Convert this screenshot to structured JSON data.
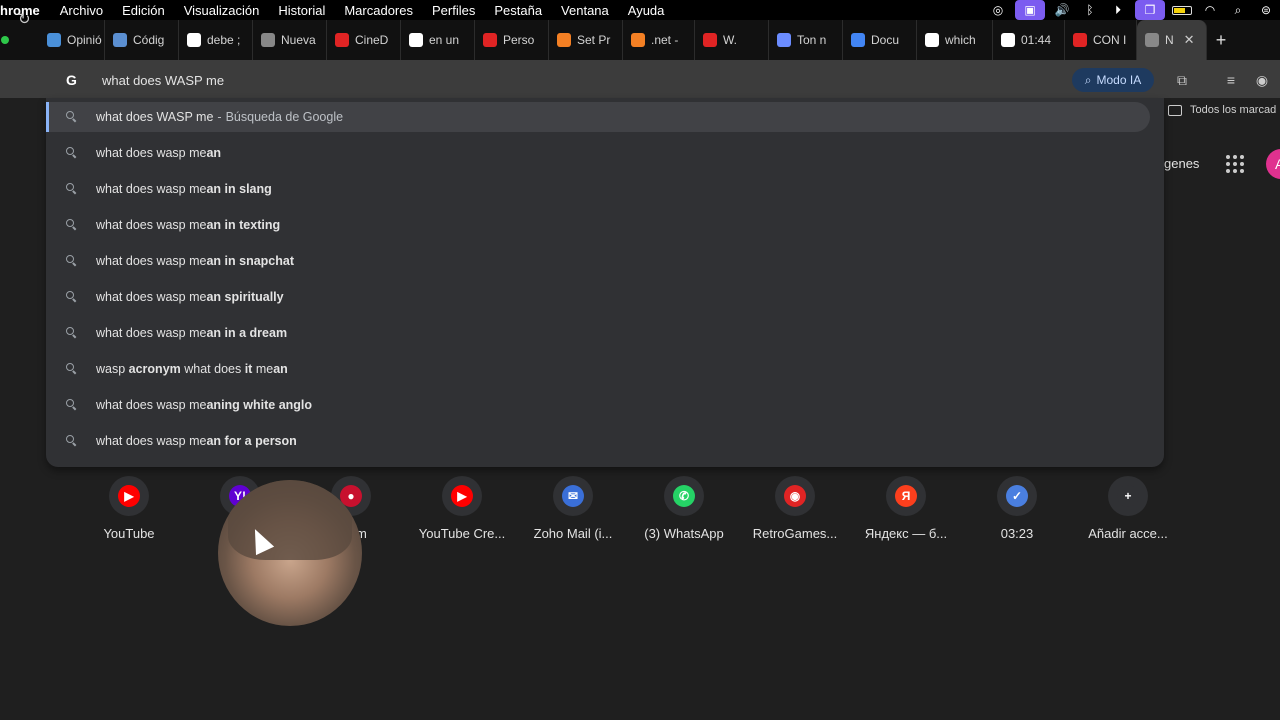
{
  "menubar": {
    "app": "hrome",
    "items": [
      "Archivo",
      "Edición",
      "Visualización",
      "Historial",
      "Marcadores",
      "Perfiles",
      "Pestaña",
      "Ventana",
      "Ayuda"
    ]
  },
  "tabs": [
    {
      "label": "Opinió",
      "color": "#4a90d9"
    },
    {
      "label": "Códig",
      "color": "#5b8fd1"
    },
    {
      "label": "debe ;",
      "color": "#ffffff"
    },
    {
      "label": "Nueva",
      "color": "#888888"
    },
    {
      "label": "CineD",
      "color": "#e02424"
    },
    {
      "label": "en un",
      "color": "#ffffff"
    },
    {
      "label": "Perso",
      "color": "#e02424"
    },
    {
      "label": "Set Pr",
      "color": "#f48024"
    },
    {
      "label": ".net -",
      "color": "#f48024"
    },
    {
      "label": "W.",
      "color": "#e02424"
    },
    {
      "label": "Ton n",
      "color": "#6b8cff"
    },
    {
      "label": "Docu",
      "color": "#4285f4"
    },
    {
      "label": "which",
      "color": "#ffffff"
    },
    {
      "label": "01:44",
      "color": "#ffffff"
    },
    {
      "label": "CON I",
      "color": "#e02424"
    },
    {
      "label": "N",
      "color": "#888888",
      "active": true
    }
  ],
  "omnibox": {
    "value": "what does WASP me",
    "modo_ia": "Modo IA"
  },
  "bookmarks": {
    "all_bookmarks": "Todos los marcad"
  },
  "google_page": {
    "images_link": "genes",
    "avatar_letter": "A"
  },
  "suggestions": [
    {
      "parts": [
        {
          "t": "what does WASP me",
          "b": false
        }
      ],
      "suffix_sep": "-",
      "suffix": "Búsqueda de Google",
      "selected": true
    },
    {
      "parts": [
        {
          "t": "what does wasp me",
          "b": false
        },
        {
          "t": "an",
          "b": true
        }
      ]
    },
    {
      "parts": [
        {
          "t": "what does wasp me",
          "b": false
        },
        {
          "t": "an in slang",
          "b": true
        }
      ]
    },
    {
      "parts": [
        {
          "t": "what does wasp me",
          "b": false
        },
        {
          "t": "an in texting",
          "b": true
        }
      ]
    },
    {
      "parts": [
        {
          "t": "what does wasp me",
          "b": false
        },
        {
          "t": "an in snapchat",
          "b": true
        }
      ]
    },
    {
      "parts": [
        {
          "t": "what does wasp me",
          "b": false
        },
        {
          "t": "an spiritually",
          "b": true
        }
      ]
    },
    {
      "parts": [
        {
          "t": "what does wasp me",
          "b": false
        },
        {
          "t": "an in a dream",
          "b": true
        }
      ]
    },
    {
      "parts": [
        {
          "t": "wasp ",
          "b": false
        },
        {
          "t": "acronym",
          "b": true
        },
        {
          "t": " what does ",
          "b": false
        },
        {
          "t": "it",
          "b": true
        },
        {
          "t": " me",
          "b": false
        },
        {
          "t": "an",
          "b": true
        }
      ]
    },
    {
      "parts": [
        {
          "t": "what does wasp me",
          "b": false
        },
        {
          "t": "aning white anglo",
          "b": true
        }
      ]
    },
    {
      "parts": [
        {
          "t": "what does wasp me",
          "b": false
        },
        {
          "t": "an for a person",
          "b": true
        }
      ]
    }
  ],
  "shortcuts": [
    {
      "label": "YouTube",
      "icon": "youtube-icon",
      "color": "#ff0000",
      "glyph": "▶"
    },
    {
      "label": "",
      "icon": "yahoo-icon",
      "color": "#6001d2",
      "glyph": "Y!"
    },
    {
      "label": "r.com",
      "icon": "site-icon",
      "color": "#c8102e",
      "glyph": "●"
    },
    {
      "label": "YouTube Cre...",
      "icon": "youtube-icon",
      "color": "#ff0000",
      "glyph": "▶"
    },
    {
      "label": "Zoho Mail (i...",
      "icon": "zoho-mail-icon",
      "color": "#3a6fd8",
      "glyph": "✉"
    },
    {
      "label": "(3) WhatsApp",
      "icon": "whatsapp-icon",
      "color": "#25d366",
      "glyph": "✆"
    },
    {
      "label": "RetroGames...",
      "icon": "retrogames-icon",
      "color": "#e02424",
      "glyph": "◉"
    },
    {
      "label": "Яндекс — б...",
      "icon": "yandex-icon",
      "color": "#fc3f1d",
      "glyph": "Я"
    },
    {
      "label": "03:23",
      "icon": "clock-icon",
      "color": "#4a7fe0",
      "glyph": "✓"
    },
    {
      "label": "Añadir acce...",
      "icon": "add-shortcut-icon",
      "color": "#303134",
      "glyph": "+"
    }
  ]
}
